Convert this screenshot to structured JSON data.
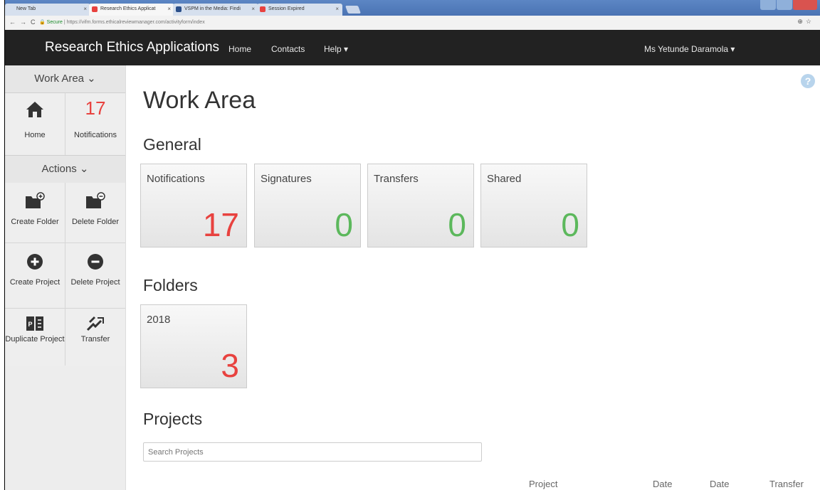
{
  "browser": {
    "tabs": [
      {
        "label": "New Tab"
      },
      {
        "label": "Research Ethics Applicat"
      },
      {
        "label": "VSPM in the Media: Findi"
      },
      {
        "label": "Session Expired"
      }
    ],
    "address_secure": "Secure",
    "address_url": "https://vifm.forms.ethicalreviewmanager.com/activityform/index"
  },
  "navbar": {
    "brand": "Research Ethics Applications",
    "links": [
      "Home",
      "Contacts",
      "Help ▾"
    ],
    "user": "Ms Yetunde Daramola ▾"
  },
  "sidebar": {
    "work_area_header": "Work Area ⌄",
    "home_label": "Home",
    "notifications_count": "17",
    "notifications_label": "Notifications",
    "actions_header": "Actions ⌄",
    "create_folder_label": "Create Folder",
    "delete_folder_label": "Delete Folder",
    "create_project_label": "Create Project",
    "delete_project_label": "Delete Project",
    "duplicate_project_label": "Duplicate Project",
    "transfer_label": "Transfer"
  },
  "main": {
    "title": "Work Area",
    "general_heading": "General",
    "cards": [
      {
        "title": "Notifications",
        "value": "17",
        "color": "#e8423f"
      },
      {
        "title": "Signatures",
        "value": "0",
        "color": "#5cb85c"
      },
      {
        "title": "Transfers",
        "value": "0",
        "color": "#5cb85c"
      },
      {
        "title": "Shared",
        "value": "0",
        "color": "#5cb85c"
      }
    ],
    "folders_heading": "Folders",
    "folders": [
      {
        "title": "2018",
        "value": "3",
        "color": "#e8423f"
      }
    ],
    "projects_heading": "Projects",
    "search_placeholder": "Search Projects",
    "table_headers": [
      "Project",
      "Date",
      "Date",
      "Transfer"
    ]
  },
  "colors": {
    "navbar_bg": "#222222",
    "accent_red": "#e8423f",
    "accent_green": "#5cb85c"
  },
  "icons": [
    "home-icon",
    "folder-plus-icon",
    "folder-minus-icon",
    "plus-circle-icon",
    "minus-circle-icon",
    "duplicate-icon",
    "transfer-icon",
    "help-icon"
  ]
}
